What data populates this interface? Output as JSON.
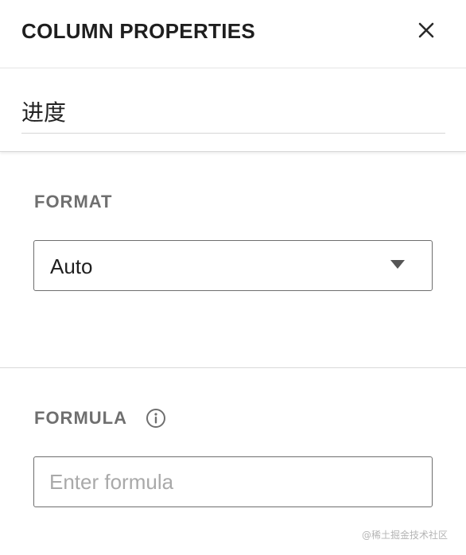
{
  "header": {
    "title": "COLUMN PROPERTIES",
    "close_icon": "close-icon"
  },
  "column": {
    "name_value": "进度"
  },
  "format": {
    "label": "FORMAT",
    "selected": "Auto",
    "caret_icon": "chevron-down-icon"
  },
  "formula": {
    "label": "FORMULA",
    "info_icon": "info-icon",
    "placeholder": "Enter formula",
    "value": ""
  },
  "watermark": "@稀土掘金技术社区",
  "colors": {
    "title": "#1e1e1e",
    "label": "#6f6f6f",
    "border": "#6e6e6e",
    "placeholder": "#a9a9a9"
  }
}
